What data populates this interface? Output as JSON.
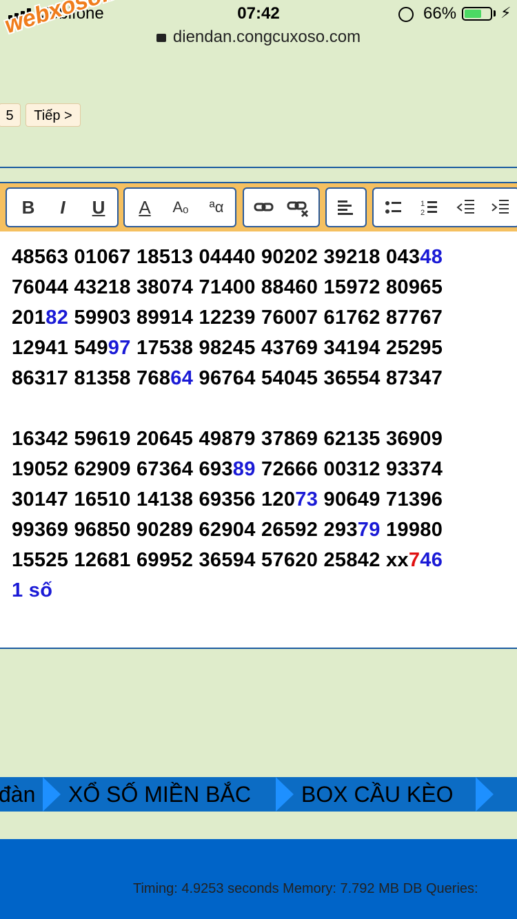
{
  "status": {
    "carrier": "Mobifone",
    "time": "07:42",
    "battery": "66%",
    "battery_level": 0.66,
    "url": "diendan.congcuxoso.com"
  },
  "watermark": "webxoso.net",
  "pagination": {
    "page": "5",
    "next": "Tiếp >"
  },
  "toolbar": {
    "bold": "B",
    "italic": "I",
    "underline": "U",
    "font_color": "A",
    "font_size": "Aₒ",
    "font": "ªα"
  },
  "lines": [
    [
      {
        "t": "48563 01067 18513 04440 90202 39218 043"
      },
      {
        "t": "48",
        "c": "blue"
      }
    ],
    [
      {
        "t": "76044 43218 38074 71400 88460 15972 80965"
      }
    ],
    [
      {
        "t": "201"
      },
      {
        "t": "82",
        "c": "blue"
      },
      {
        "t": " 59903 89914 12239 76007 61762 87767"
      }
    ],
    [
      {
        "t": "12941 549"
      },
      {
        "t": "97",
        "c": "blue"
      },
      {
        "t": " 17538 98245 43769 34194 25295"
      }
    ],
    [
      {
        "t": "86317 81358 768"
      },
      {
        "t": "64",
        "c": "blue"
      },
      {
        "t": " 96764 54045 36554 87347"
      }
    ],
    [
      {
        "t": "16342 59619 20645 49879 37869 62135 36909"
      }
    ],
    [
      {
        "t": "19052 62909 67364 693"
      },
      {
        "t": "89",
        "c": "blue"
      },
      {
        "t": " 72666 00312 93374"
      }
    ],
    [
      {
        "t": "30147 16510 14138 69356 120"
      },
      {
        "t": "73",
        "c": "blue"
      },
      {
        "t": " 90649 71396"
      }
    ],
    [
      {
        "t": "99369 96850 90289 62904 26592 293"
      },
      {
        "t": "79",
        "c": "blue"
      },
      {
        "t": " 19980"
      }
    ],
    [
      {
        "t": "15525 12681 69952 36594 57620 25842 xx"
      },
      {
        "t": "7",
        "c": "red"
      },
      {
        "t": "46",
        "c": "blue"
      }
    ],
    [
      {
        "t": "1 số",
        "c": "blue"
      }
    ]
  ],
  "nav": {
    "item0": "đàn",
    "item1": "XỔ SỐ MIỀN BẮC",
    "item2": "BOX CẦU KÈO"
  },
  "footer": {
    "timing": "Timing: 4.9253 seconds Memory: 7.792 MB DB Queries:"
  }
}
